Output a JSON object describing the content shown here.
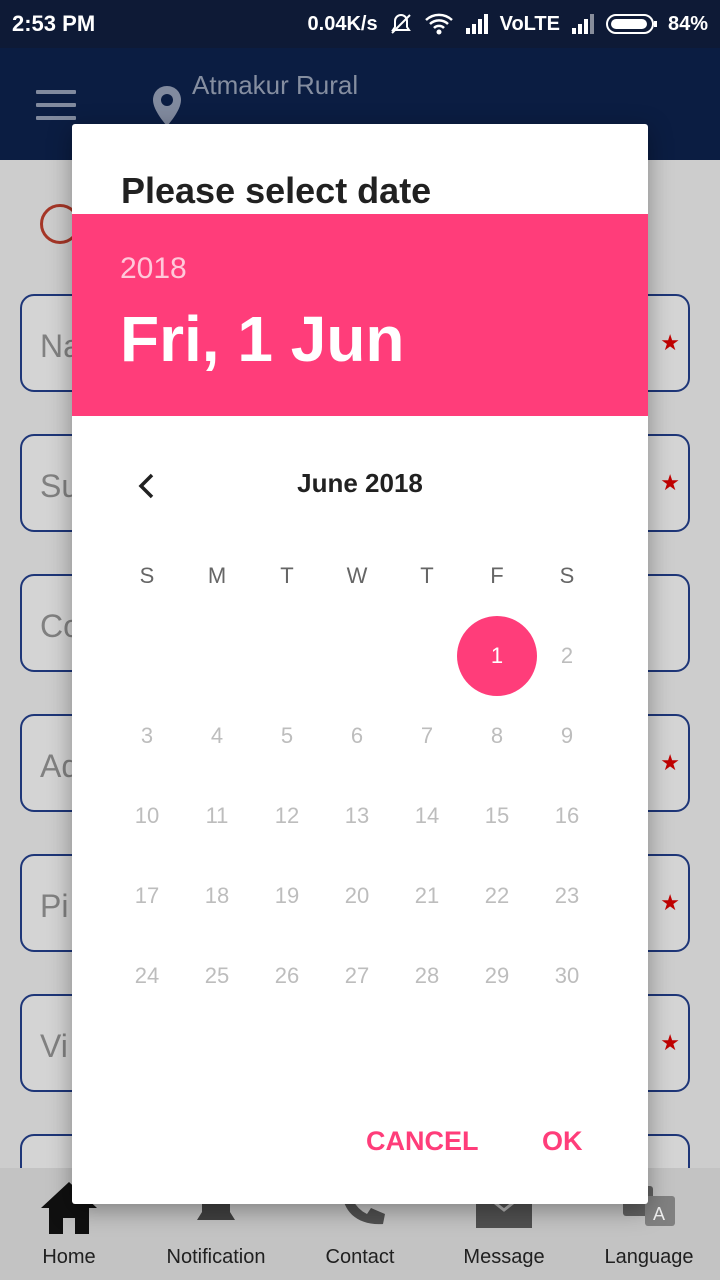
{
  "status_bar": {
    "time": "2:53 PM",
    "speed": "0.04K/s",
    "network": "VoLTE",
    "battery": "84%"
  },
  "app_bar": {
    "location": "Atmakur Rural"
  },
  "form": {
    "fields": [
      {
        "placeholder": "Na",
        "required": true
      },
      {
        "placeholder": "Su",
        "required": true
      },
      {
        "placeholder": "Co",
        "required": false
      },
      {
        "placeholder": "Ad",
        "required": true
      },
      {
        "placeholder": "Pi",
        "required": true
      },
      {
        "placeholder": "Vi",
        "required": true
      }
    ]
  },
  "dialog": {
    "title": "Please select date",
    "header_year": "2018",
    "header_date": "Fri, 1 Jun",
    "month_label": "June 2018",
    "weekdays": [
      "S",
      "M",
      "T",
      "W",
      "T",
      "F",
      "S"
    ],
    "weeks": [
      [
        "",
        "",
        "",
        "",
        "",
        "1",
        "2"
      ],
      [
        "3",
        "4",
        "5",
        "6",
        "7",
        "8",
        "9"
      ],
      [
        "10",
        "11",
        "12",
        "13",
        "14",
        "15",
        "16"
      ],
      [
        "17",
        "18",
        "19",
        "20",
        "21",
        "22",
        "23"
      ],
      [
        "24",
        "25",
        "26",
        "27",
        "28",
        "29",
        "30"
      ]
    ],
    "selected_day": "1",
    "cancel_label": "CANCEL",
    "ok_label": "OK"
  },
  "bottom_nav": {
    "items": [
      {
        "label": "Home",
        "icon": "home-icon"
      },
      {
        "label": "Notification",
        "icon": "bell-icon"
      },
      {
        "label": "Contact",
        "icon": "phone-icon"
      },
      {
        "label": "Message",
        "icon": "mail-icon"
      },
      {
        "label": "Language",
        "icon": "language-icon"
      }
    ]
  },
  "colors": {
    "accent": "#ff3d7a",
    "app_bar": "#0c1f47",
    "status_bar": "#0e1a36"
  }
}
